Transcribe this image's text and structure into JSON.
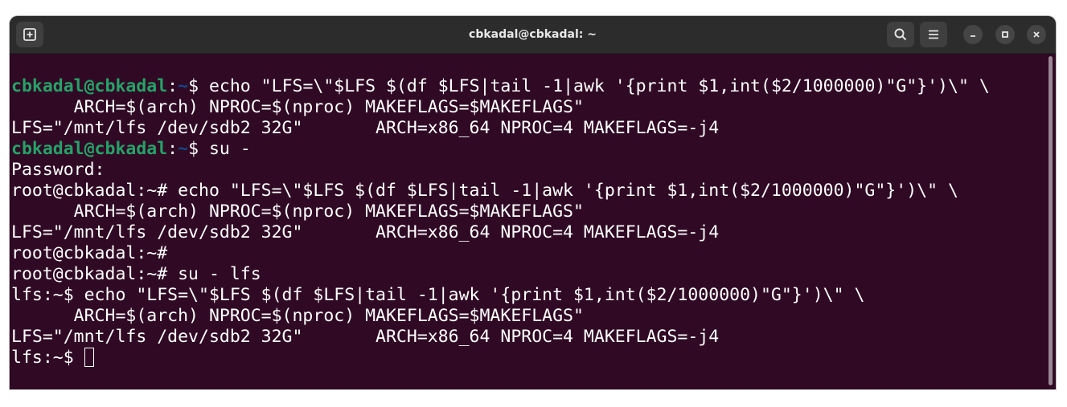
{
  "window": {
    "title": "cbkadal@cbkadal: ~",
    "background": "#300a24",
    "titlebar_color": "#2c2c2c"
  },
  "toolbar": {
    "new_tab_icon": "new-tab-icon",
    "search_icon": "search-icon",
    "menu_icon": "hamburger-menu-icon",
    "minimize_icon": "minimize-icon",
    "maximize_icon": "maximize-icon",
    "close_icon": "close-icon"
  },
  "colors": {
    "prompt_user": "#26a269",
    "prompt_path": "#12488b",
    "text": "#ffffff"
  },
  "terminal": {
    "lines": [
      {
        "user": "cbkadal@cbkadal",
        "sep": ":",
        "path": "~",
        "tail": "$ echo \"LFS=\\\"$LFS $(df $LFS|tail -1|awk '{print $1,int($2/1000000)\"G\"}')\\\" \\"
      },
      {
        "text": "      ARCH=$(arch) NPROC=$(nproc) MAKEFLAGS=$MAKEFLAGS\""
      },
      {
        "text": "LFS=\"/mnt/lfs /dev/sdb2 32G\"       ARCH=x86_64 NPROC=4 MAKEFLAGS=-j4"
      },
      {
        "user": "cbkadal@cbkadal",
        "sep": ":",
        "path": "~",
        "tail": "$ su -"
      },
      {
        "text": "Password:"
      },
      {
        "text": "root@cbkadal:~# echo \"LFS=\\\"$LFS $(df $LFS|tail -1|awk '{print $1,int($2/1000000)\"G\"}')\\\" \\"
      },
      {
        "text": "      ARCH=$(arch) NPROC=$(nproc) MAKEFLAGS=$MAKEFLAGS\""
      },
      {
        "text": "LFS=\"/mnt/lfs /dev/sdb2 32G\"       ARCH=x86_64 NPROC=4 MAKEFLAGS=-j4"
      },
      {
        "text": "root@cbkadal:~#"
      },
      {
        "text": "root@cbkadal:~# su - lfs"
      },
      {
        "text": "lfs:~$ echo \"LFS=\\\"$LFS $(df $LFS|tail -1|awk '{print $1,int($2/1000000)\"G\"}')\\\" \\"
      },
      {
        "text": "      ARCH=$(arch) NPROC=$(nproc) MAKEFLAGS=$MAKEFLAGS\""
      },
      {
        "text": "LFS=\"/mnt/lfs /dev/sdb2 32G\"       ARCH=x86_64 NPROC=4 MAKEFLAGS=-j4"
      },
      {
        "text": "lfs:~$ "
      }
    ]
  }
}
